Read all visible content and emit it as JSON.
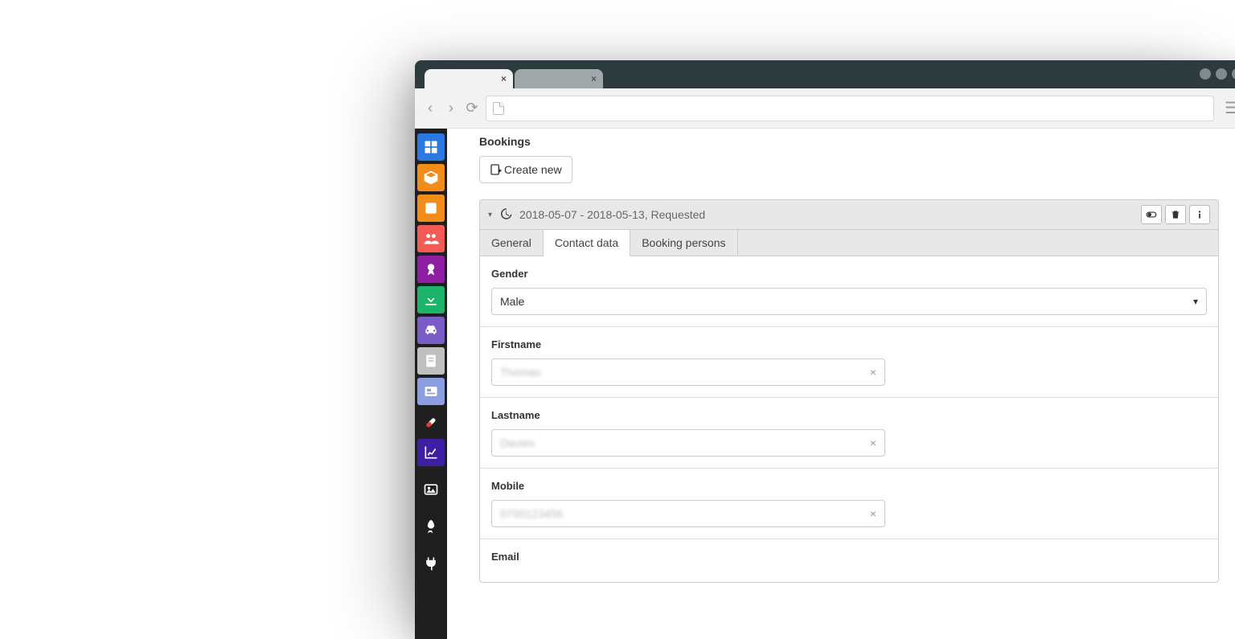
{
  "tabs": {
    "close_label": "×"
  },
  "section": {
    "title": "Bookings"
  },
  "buttons": {
    "create_new": "Create new"
  },
  "panel": {
    "header_text": "2018-05-07 - 2018-05-13, Requested"
  },
  "ptabs": {
    "general": "General",
    "contact": "Contact data",
    "persons": "Booking persons"
  },
  "form": {
    "gender_label": "Gender",
    "gender_value": "Male",
    "firstname_label": "Firstname",
    "firstname_value": "Thomas",
    "lastname_label": "Lastname",
    "lastname_value": "Davies",
    "mobile_label": "Mobile",
    "mobile_value": "0700123456",
    "email_label": "Email"
  },
  "sidebar_colors": {
    "c1": "#2a7ae2",
    "c2": "#f28c1b",
    "c3": "#f28c1b",
    "c4": "#f25c54",
    "c5": "#8e1fa3",
    "c6": "#1db36b",
    "c7": "#7a5cc9",
    "c8": "#bfbfbf",
    "c9": "#8b9fe0",
    "c10": "#1f1f1f",
    "c11": "#3d1fa3",
    "c12": "#1f1f1f",
    "c13": "#1f1f1f",
    "c14": "#1f1f1f"
  }
}
